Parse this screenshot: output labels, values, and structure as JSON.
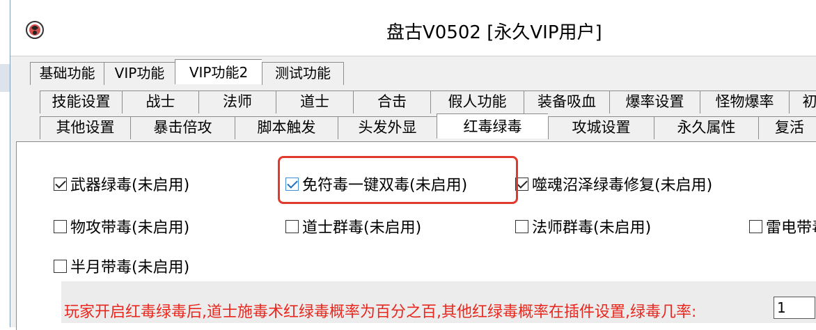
{
  "window": {
    "title": "盘古V0502 [永久VIP用户]"
  },
  "tabs_level1": [
    {
      "label": "基础功能",
      "active": false
    },
    {
      "label": "VIP功能",
      "active": false
    },
    {
      "label": "VIP功能2",
      "active": true
    },
    {
      "label": "测试功能",
      "active": false
    }
  ],
  "tabs_row2": [
    {
      "label": "技能设置"
    },
    {
      "label": "战士"
    },
    {
      "label": "法师"
    },
    {
      "label": "道士"
    },
    {
      "label": "合击"
    },
    {
      "label": "假人功能"
    },
    {
      "label": "装备吸血"
    },
    {
      "label": "爆率设置"
    },
    {
      "label": "怪物爆率"
    },
    {
      "label": "初"
    }
  ],
  "tabs_row3": [
    {
      "label": "其他设置",
      "active": false
    },
    {
      "label": "暴击倍攻",
      "active": false
    },
    {
      "label": "脚本触发",
      "active": false
    },
    {
      "label": "头发外显",
      "active": false
    },
    {
      "label": "红毒绿毒",
      "active": true
    },
    {
      "label": "攻城设置",
      "active": false
    },
    {
      "label": "永久属性",
      "active": false
    },
    {
      "label": "复活",
      "active": false
    }
  ],
  "options": {
    "weapon_green_poison": {
      "label": "武器绿毒(未启用)",
      "checked": true
    },
    "free_talisman_double_poison": {
      "label": "免符毒一键双毒(未启用)",
      "checked": true
    },
    "soul_swamp_fix": {
      "label": "噬魂沼泽绿毒修复(未启用)",
      "checked": true
    },
    "physical_attack_poison": {
      "label": "物攻带毒(未启用)",
      "checked": false
    },
    "taoist_group_poison": {
      "label": "道士群毒(未启用)",
      "checked": false
    },
    "mage_group_poison": {
      "label": "法师群毒(未启用)",
      "checked": false
    },
    "thunder_poison": {
      "label": "雷电带毒",
      "checked": false
    },
    "half_moon_poison": {
      "label": "半月带毒(未启用)",
      "checked": false
    }
  },
  "notice": {
    "text": "玩家开启红毒绿毒后,道士施毒术红绿毒概率为百分之百,其他红绿毒概率在插件设置,绿毒几率:",
    "rate_value": "1"
  },
  "colors": {
    "notice_text": "#e8281e",
    "highlight_border": "#e03a2e",
    "checkbox_blue": "#3c8fd8"
  }
}
